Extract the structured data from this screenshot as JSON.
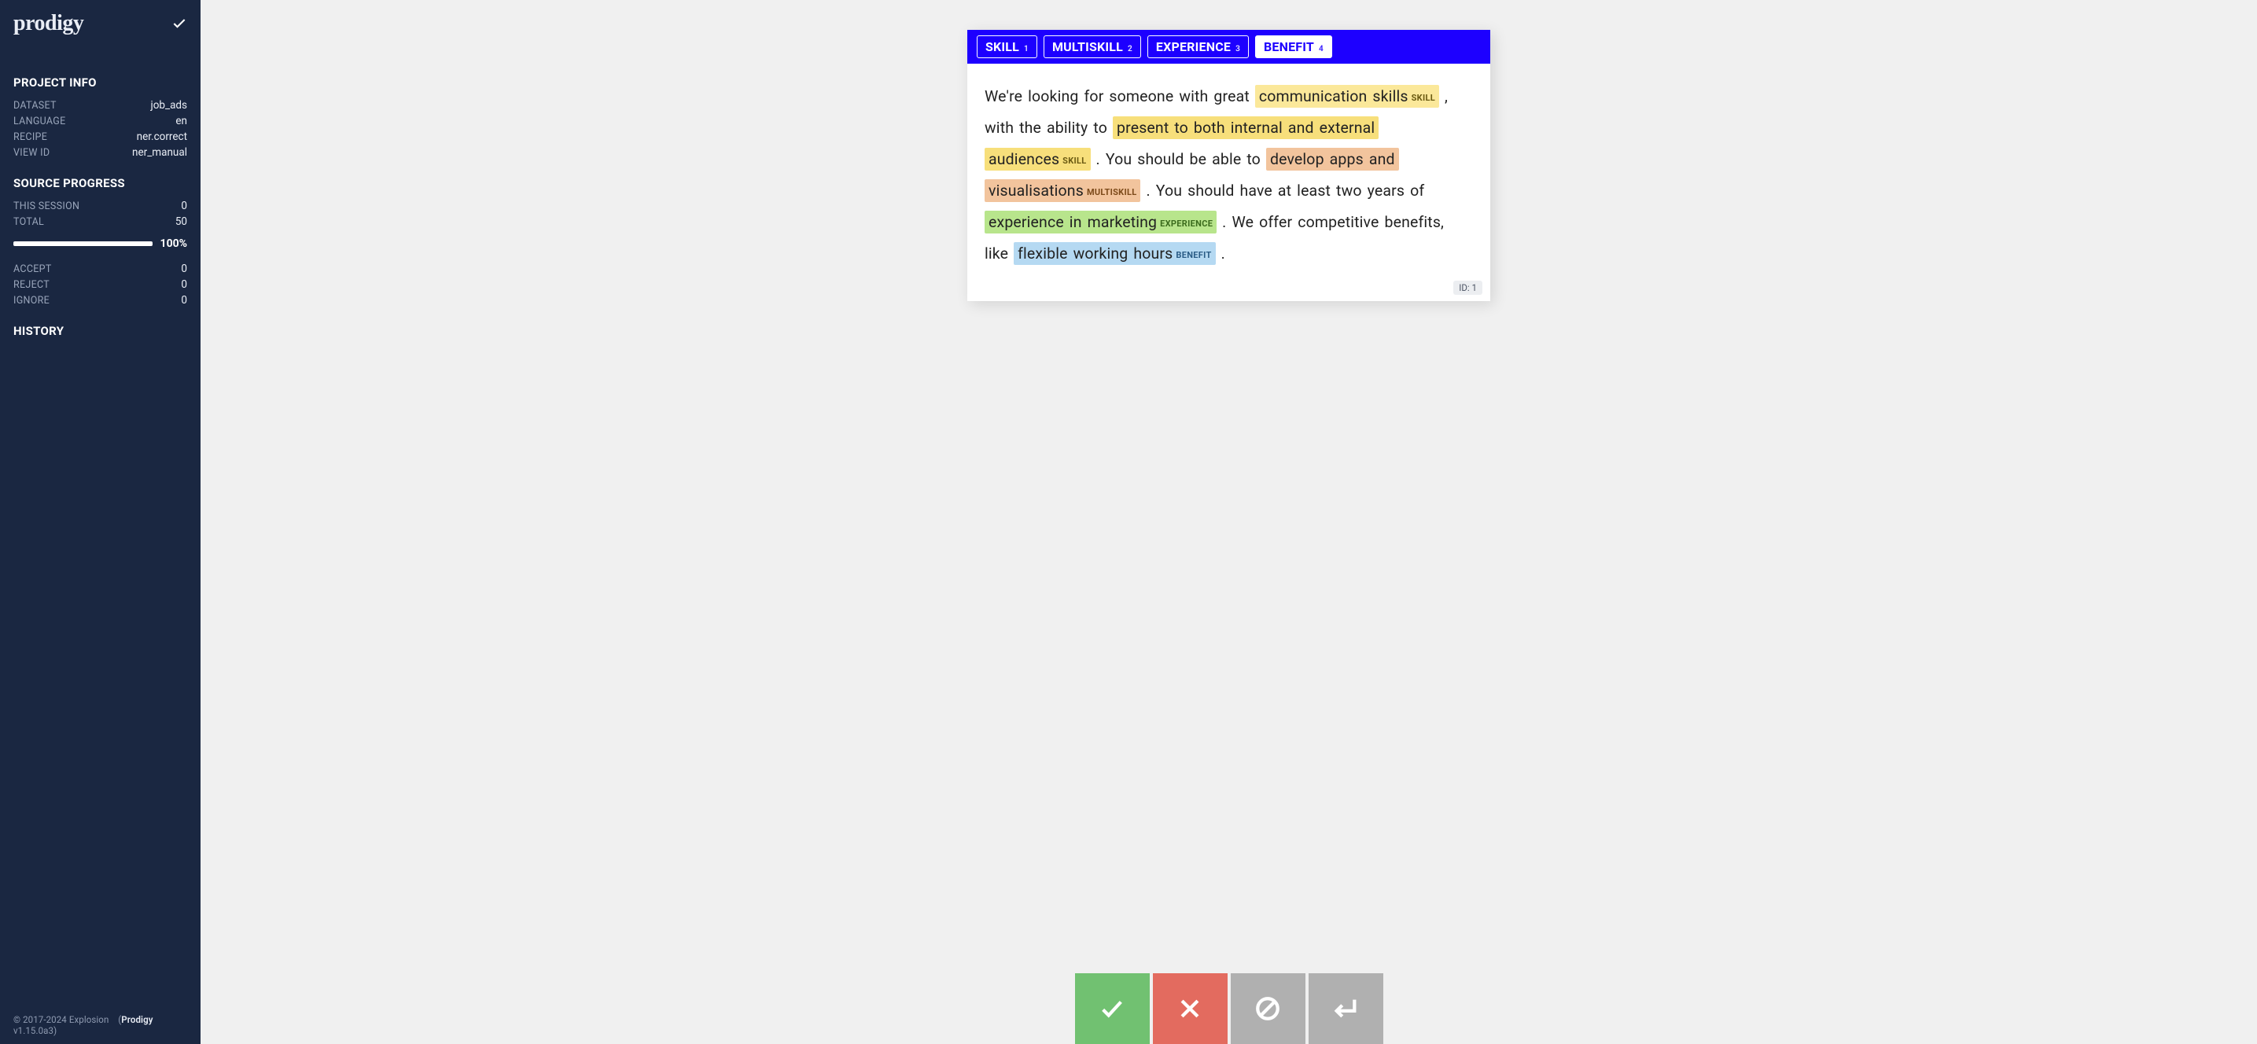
{
  "brand": "prodigy",
  "sections": {
    "project_info_title": "PROJECT INFO",
    "source_progress_title": "SOURCE PROGRESS",
    "history_title": "HISTORY"
  },
  "project": {
    "rows": [
      {
        "label": "DATASET",
        "value": "job_ads"
      },
      {
        "label": "LANGUAGE",
        "value": "en"
      },
      {
        "label": "RECIPE",
        "value": "ner.correct"
      },
      {
        "label": "VIEW ID",
        "value": "ner_manual"
      }
    ]
  },
  "progress": {
    "session_label": "THIS SESSION",
    "session_value": "0",
    "total_label": "TOTAL",
    "total_value": "50",
    "percent_text": "100%",
    "percent_value": 100
  },
  "counts": {
    "rows": [
      {
        "label": "ACCEPT",
        "value": "0"
      },
      {
        "label": "REJECT",
        "value": "0"
      },
      {
        "label": "IGNORE",
        "value": "0"
      }
    ]
  },
  "labels": [
    {
      "name": "SKILL",
      "hotkey": "1",
      "active": false
    },
    {
      "name": "MULTISKILL",
      "hotkey": "2",
      "active": false
    },
    {
      "name": "EXPERIENCE",
      "hotkey": "3",
      "active": false
    },
    {
      "name": "BENEFIT",
      "hotkey": "4",
      "active": true
    }
  ],
  "task": {
    "id_label": "ID:",
    "id_value": "1",
    "tokens": [
      {
        "t": "text",
        "value": "We're looking for someone with great "
      },
      {
        "t": "span",
        "cls": "mk-skill1",
        "text": "communication skills",
        "tag": "SKILL"
      },
      {
        "t": "text",
        "value": " , with the ability to "
      },
      {
        "t": "span",
        "cls": "mk-skill2",
        "text": "present to both internal and external audiences",
        "tag": "SKILL"
      },
      {
        "t": "text",
        "value": " . You should be able to "
      },
      {
        "t": "span",
        "cls": "mk-multiskill",
        "text": "develop apps and visualisations",
        "tag": "MULTISKILL"
      },
      {
        "t": "text",
        "value": " . You should have at least two years of "
      },
      {
        "t": "span",
        "cls": "mk-experience",
        "text": "experience in marketing",
        "tag": "EXPERIENCE"
      },
      {
        "t": "text",
        "value": " . We offer competitive benefits, like "
      },
      {
        "t": "span",
        "cls": "mk-benefit",
        "text": "flexible working hours",
        "tag": "BENEFIT"
      },
      {
        "t": "text",
        "value": " ."
      }
    ]
  },
  "footer": {
    "copyright": "© 2017-2024 Explosion",
    "app_name": "Prodigy",
    "version_prefix": " (",
    "version": " v1.15.0a3)",
    "full": "© 2017-2024 Explosion   (Prodigy v1.15.0a3)"
  }
}
